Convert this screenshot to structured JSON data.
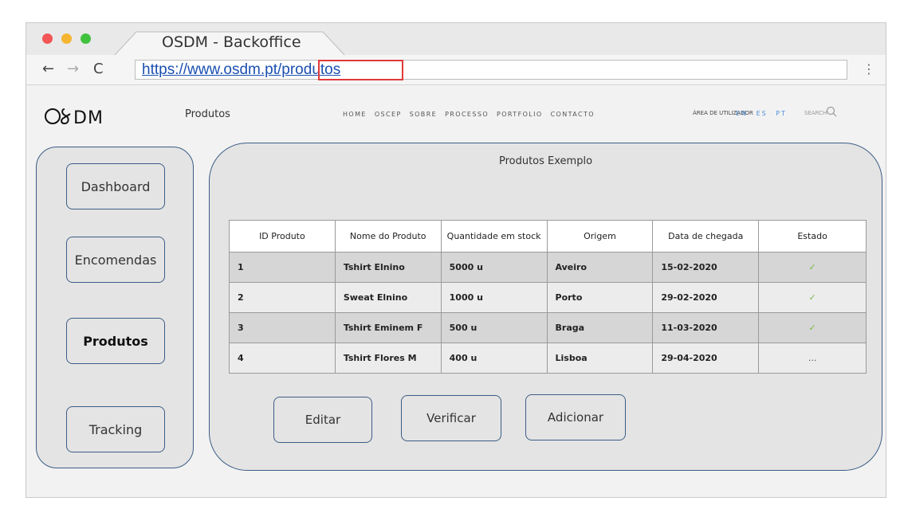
{
  "browser": {
    "tab_title": "OSDM - Backoffice",
    "url": "https://www.osdm.pt/produtos",
    "nav": {
      "back": "←",
      "forward": "→",
      "reload": "C",
      "menu": "⋮"
    },
    "traffic_light_colors": [
      "#f25656",
      "#f5b531",
      "#41c23f"
    ],
    "url_highlight_color": "#e03a3a"
  },
  "site": {
    "logo": "O⁄DM",
    "page_label": "Produtos",
    "nav_links": [
      "HOME",
      "OSCEP",
      "SOBRE",
      "PROCESSO",
      "PORTFOLIO",
      "CONTACTO"
    ],
    "user_area": "ÁREA DE UTILIZADOR",
    "languages": [
      "EN",
      "ES",
      "PT"
    ],
    "search_placeholder": "SEARCH",
    "accent_color": "#4c8fd6"
  },
  "sidebar": {
    "items": [
      {
        "label": "Dashboard",
        "active": false
      },
      {
        "label": "Encomendas",
        "active": false
      },
      {
        "label": "Produtos",
        "active": true
      },
      {
        "label": "Tracking",
        "active": false
      }
    ],
    "border_color": "#3b5d86"
  },
  "main": {
    "title": "Produtos Exemplo",
    "table": {
      "headers": [
        "ID Produto",
        "Nome do Produto",
        "Quantidade em stock",
        "Origem",
        "Data de chegada",
        "Estado"
      ],
      "rows": [
        {
          "id": "1",
          "name": "Tshirt Elnino",
          "qty": "5000 u",
          "origin": "Aveiro",
          "date": "15-02-2020",
          "status": "✓"
        },
        {
          "id": "2",
          "name": "Sweat Elnino",
          "qty": "1000 u",
          "origin": "Porto",
          "date": "29-02-2020",
          "status": "✓"
        },
        {
          "id": "3",
          "name": "Tshirt Eminem F",
          "qty": "500 u",
          "origin": "Braga",
          "date": "11-03-2020",
          "status": "✓"
        },
        {
          "id": "4",
          "name": "Tshirt Flores M",
          "qty": "400 u",
          "origin": "Lisboa",
          "date": "29-04-2020",
          "status": "..."
        }
      ],
      "status_ok_color": "#7ab848"
    },
    "actions": {
      "edit": "Editar",
      "verify": "Verificar",
      "add": "Adicionar"
    }
  }
}
